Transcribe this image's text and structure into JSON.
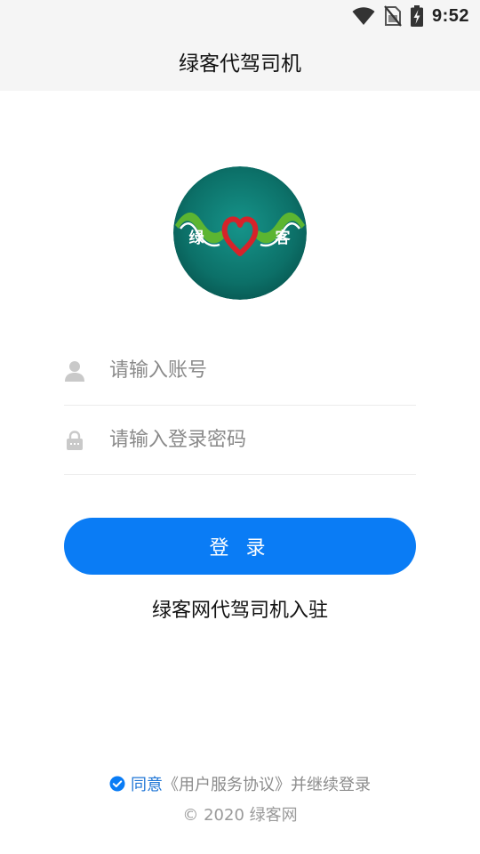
{
  "status_bar": {
    "time": "9:52",
    "icons": [
      "wifi-icon",
      "no-sim-icon",
      "battery-charging-icon"
    ]
  },
  "header": {
    "title": "绿客代驾司机"
  },
  "logo": {
    "left_char": "绿",
    "right_char": "客",
    "colors": {
      "background": "#0f7d74",
      "wings": "#59b52f",
      "heart": "#d6232a"
    }
  },
  "login_form": {
    "account_placeholder": "请输入账号",
    "password_placeholder": "请输入登录密码",
    "account_icon": "user-icon",
    "password_icon": "lock-icon",
    "submit_label": "登 录"
  },
  "register_link": "绿客网代驾司机入驻",
  "agreement": {
    "agree_label": "同意",
    "link_label": "《用户服务协议》",
    "tail": "并继续登录",
    "checked": true
  },
  "footer": {
    "copyright": "© 2020 绿客网"
  },
  "colors": {
    "accent": "#0a7cf5",
    "header_bg": "#f5f5f5",
    "placeholder": "#8a8a8a"
  }
}
